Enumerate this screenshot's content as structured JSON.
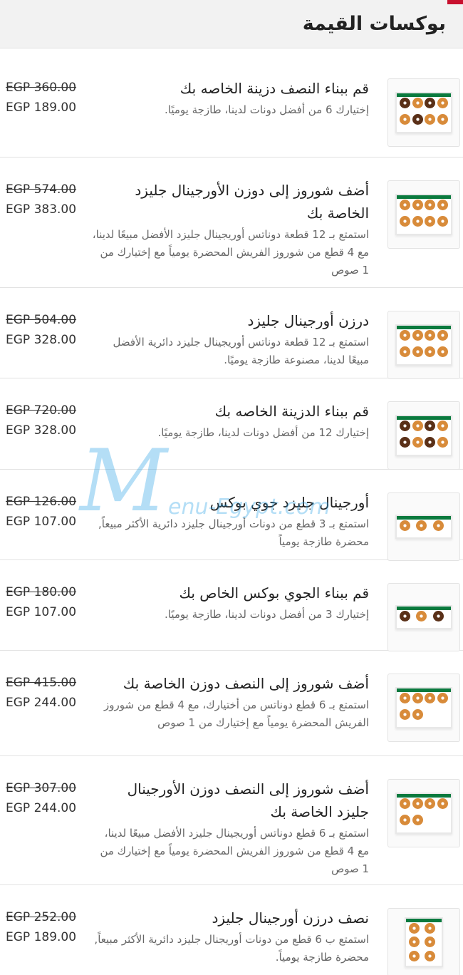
{
  "header": {
    "title": "بوكسات القيمة"
  },
  "watermark": {
    "main": "M",
    "small": "enu-Egypt.com"
  },
  "items": [
    {
      "title": "قم ببناء النصف دزينة الخاصه بك",
      "desc": "إختيارك 6 من أفضل دونات لدينا، طازجة يوميًا.",
      "old_price": "EGP 360.00",
      "new_price": "EGP 189.00"
    },
    {
      "title": "أضف شوروز إلى دوزن الأورجينال جليزد الخاصة بك",
      "desc": "استمتع بـ 12 قطعة دوناتس أوريجينال جليزد الأفضل مبيعًا لدينا، مع 4 قطع من شوروز الفريش المحضرة يومياً مع إختيارك من 1 صوص",
      "old_price": "EGP 574.00",
      "new_price": "EGP 383.00"
    },
    {
      "title": "درزن أورجينال جليزد",
      "desc": "استمتع بـ 12 قطعة دوناتس أوريجينال جليزد دائرية الأفضل مبيعًا لدينا، مصنوعة طازجة يوميًا.",
      "old_price": "EGP 504.00",
      "new_price": "EGP 328.00"
    },
    {
      "title": "قم ببناء الدزينة الخاصه بك",
      "desc": "إختيارك 12 من أفضل دونات لدينا، طازجة يوميًا.",
      "old_price": "EGP 720.00",
      "new_price": "EGP 328.00"
    },
    {
      "title": "أورجينال جليزد جوي بوكس",
      "desc": "استمتع بـ 3 قطع من دونات أورجينال جليزد دائرية الأكثر مبيعاً, محضرة طازجة يومياً",
      "old_price": "EGP 126.00",
      "new_price": "EGP 107.00"
    },
    {
      "title": "قم ببناء الجوي بوكس الخاص بك",
      "desc": "إختيارك 3 من أفضل دونات لدينا، طازجة يوميًا.",
      "old_price": "EGP 180.00",
      "new_price": "EGP 107.00"
    },
    {
      "title": "أضف شوروز إلى النصف دوزن الخاصة بك",
      "desc": "استمتع بـ 6 قطع دوناتس من أختيارك، مع 4 قطع من شوروز الفريش المحضرة يومياً مع إختيارك من 1 صوص",
      "old_price": "EGP 415.00",
      "new_price": "EGP 244.00"
    },
    {
      "title": "أضف شوروز إلى النصف دوزن الأورجينال جليزد الخاصة بك",
      "desc": "استمتع بـ 6 قطع دوناتس أوريجينال جليزد الأفضل مبيعًا لدينا، مع 4 قطع من شوروز الفريش المحضرة يومياً مع إختيارك من 1 صوص",
      "old_price": "EGP 307.00",
      "new_price": "EGP 244.00"
    },
    {
      "title": "نصف درزن أورجينال جليزد",
      "desc": "استمتع ب 6 قطع من دونات أوريجنال جليزد دائرية الأكثر مبيعاً, محضرة طازجة يومياً.",
      "old_price": "EGP 252.00",
      "new_price": "EGP 189.00"
    }
  ]
}
